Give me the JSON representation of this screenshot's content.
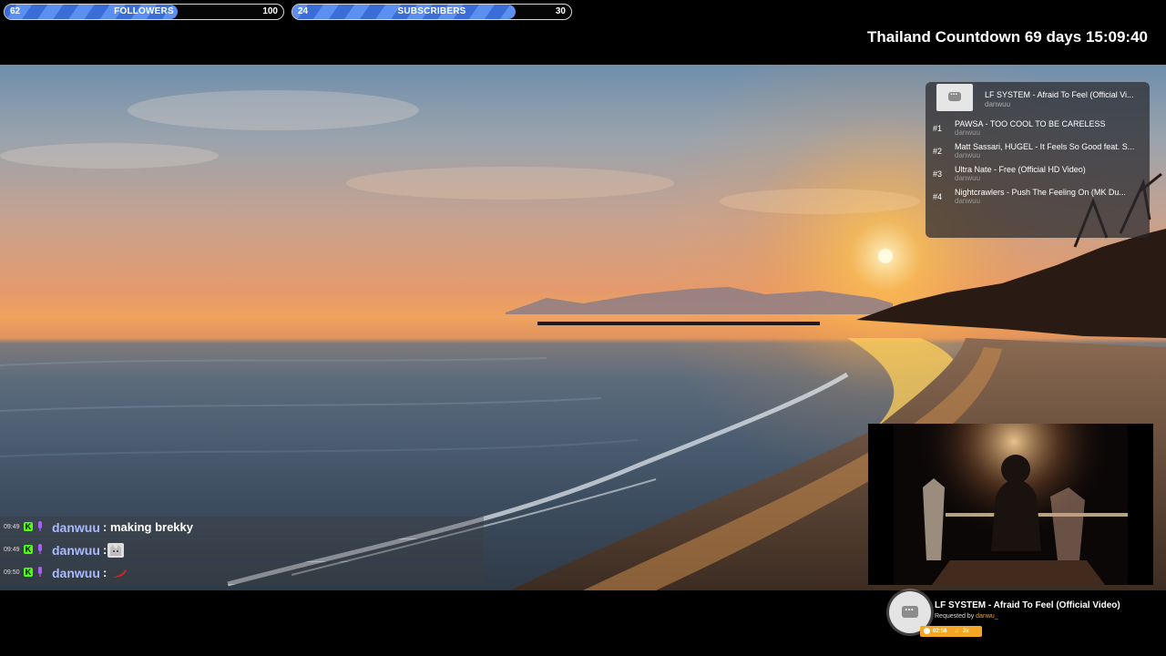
{
  "goals": {
    "followers": {
      "current": "62",
      "label": "FOLLOWERS",
      "max": "100",
      "progress": 0.62
    },
    "subscribers": {
      "current": "24",
      "label": "SUBSCRIBERS",
      "max": "30",
      "progress": 0.8
    }
  },
  "countdown": "Thailand Countdown 69 days 15:09:40",
  "playlist": {
    "now": {
      "title": "LF SYSTEM - Afraid To Feel (Official Vi...",
      "user": "danwuu"
    },
    "items": [
      {
        "num": "#1",
        "title": "PAWSA - TOO COOL TO BE CARELESS",
        "user": "danwuu"
      },
      {
        "num": "#2",
        "title": "Matt Sassari, HUGEL - It Feels So Good feat. S...",
        "user": "danwuu"
      },
      {
        "num": "#3",
        "title": "Ultra Nate - Free (Official HD Video)",
        "user": "danwuu"
      },
      {
        "num": "#4",
        "title": "Nightcrawlers - Push The Feeling On (MK Du...",
        "user": "danwuu"
      }
    ]
  },
  "chat": [
    {
      "time": "09:49",
      "user": "danwuu",
      "message": ": making brekky"
    },
    {
      "time": "09:49",
      "user": "danwuu",
      "message": ":"
    },
    {
      "time": "09:50",
      "user": "danwuu",
      "message": ":"
    }
  ],
  "now_playing": {
    "title": "LF SYSTEM - Afraid To Feel (Official Video)",
    "requested_prefix": "Requested by",
    "requested_user": "danwu_",
    "time": "02:58",
    "count": "3x"
  },
  "colors": {
    "goal_fill": "#5b8ff0",
    "chat_user": "#a9b9ff",
    "kick_green": "#53fc18",
    "accent_orange": "#f5a623"
  }
}
